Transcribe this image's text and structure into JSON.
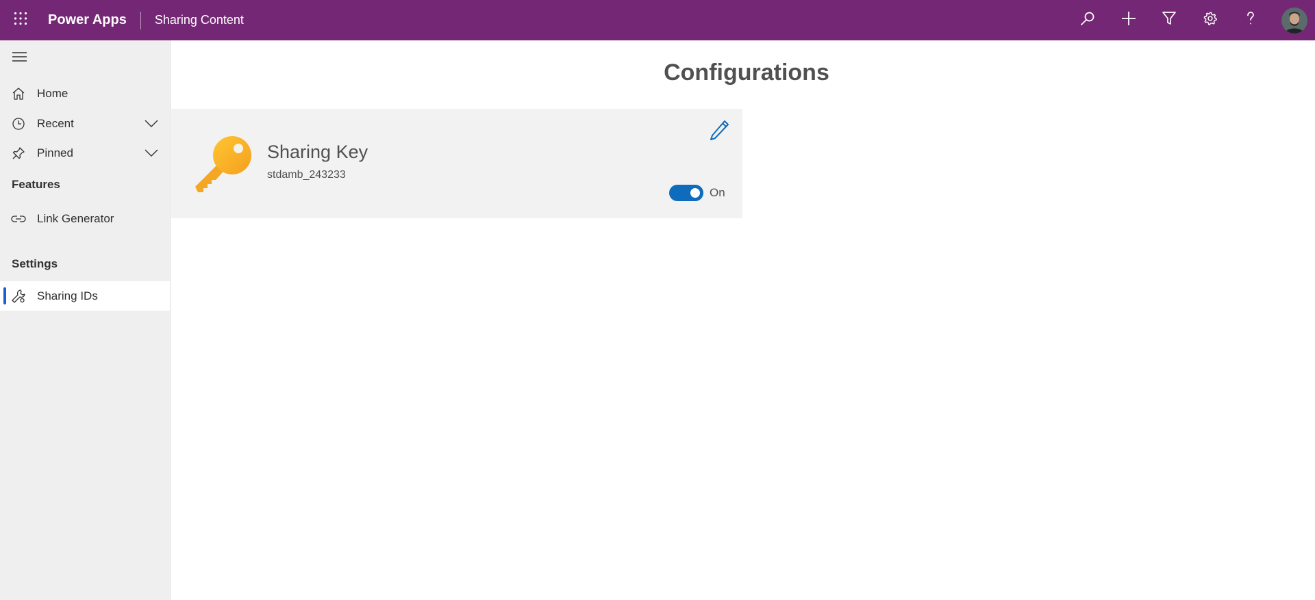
{
  "topbar": {
    "app_name": "Power Apps",
    "app_title": "Sharing Content",
    "background": "#742774",
    "icons": [
      "waffle-icon",
      "search-icon",
      "add-icon",
      "filter-icon",
      "settings-icon",
      "help-icon",
      "avatar"
    ]
  },
  "sidebar": {
    "items": [
      {
        "label": "Home",
        "icon": "home-icon"
      },
      {
        "label": "Recent",
        "icon": "clock-icon",
        "expandable": true
      },
      {
        "label": "Pinned",
        "icon": "pin-icon",
        "expandable": true
      }
    ],
    "features_title": "Features",
    "features": [
      {
        "label": "Link Generator",
        "icon": "link-icon"
      }
    ],
    "settings_title": "Settings",
    "settings": [
      {
        "label": "Sharing IDs",
        "icon": "wrench-icon",
        "selected": true
      }
    ]
  },
  "main": {
    "title": "Configurations",
    "card": {
      "title": "Sharing Key",
      "subtitle": "stdamb_243233",
      "toggle_state": true,
      "toggle_label": "On",
      "accent": "#0f6cbd",
      "icon": "key-icon"
    }
  }
}
